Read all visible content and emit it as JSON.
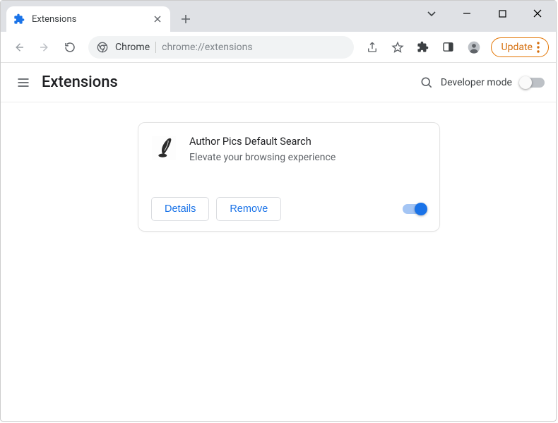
{
  "tab": {
    "title": "Extensions"
  },
  "omnibox": {
    "site": "Chrome",
    "path": "chrome://extensions"
  },
  "toolbar": {
    "update_label": "Update"
  },
  "page": {
    "title": "Extensions",
    "developer_mode_label": "Developer mode"
  },
  "extension": {
    "name": "Author Pics Default Search",
    "description": "Elevate your browsing experience",
    "details_label": "Details",
    "remove_label": "Remove"
  }
}
